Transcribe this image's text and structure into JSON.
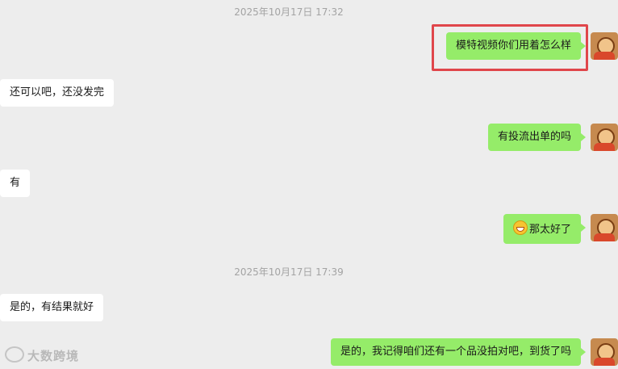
{
  "chat": {
    "timestamp1": "2025年10月17日 17:32",
    "timestamp2": "2025年10月17日 17:39",
    "messages": [
      {
        "dir": "out",
        "text": "模特视频你们用着怎么样"
      },
      {
        "dir": "in",
        "text": "还可以吧，还没发完"
      },
      {
        "dir": "out",
        "text": "有投流出单的吗"
      },
      {
        "dir": "in",
        "text": "有"
      },
      {
        "dir": "out",
        "text": "那太好了",
        "emoji": "grin-emoji"
      },
      {
        "dir": "in",
        "text": "是的，有结果就好"
      },
      {
        "dir": "out",
        "text": "是的，我记得咱们还有一个品没拍对吧，到货了吗"
      }
    ]
  },
  "watermark": {
    "text": "大数跨境"
  },
  "colors": {
    "background": "#ededed",
    "outgoing": "#95ec69",
    "incoming": "#ffffff",
    "highlight": "#e0464b"
  }
}
